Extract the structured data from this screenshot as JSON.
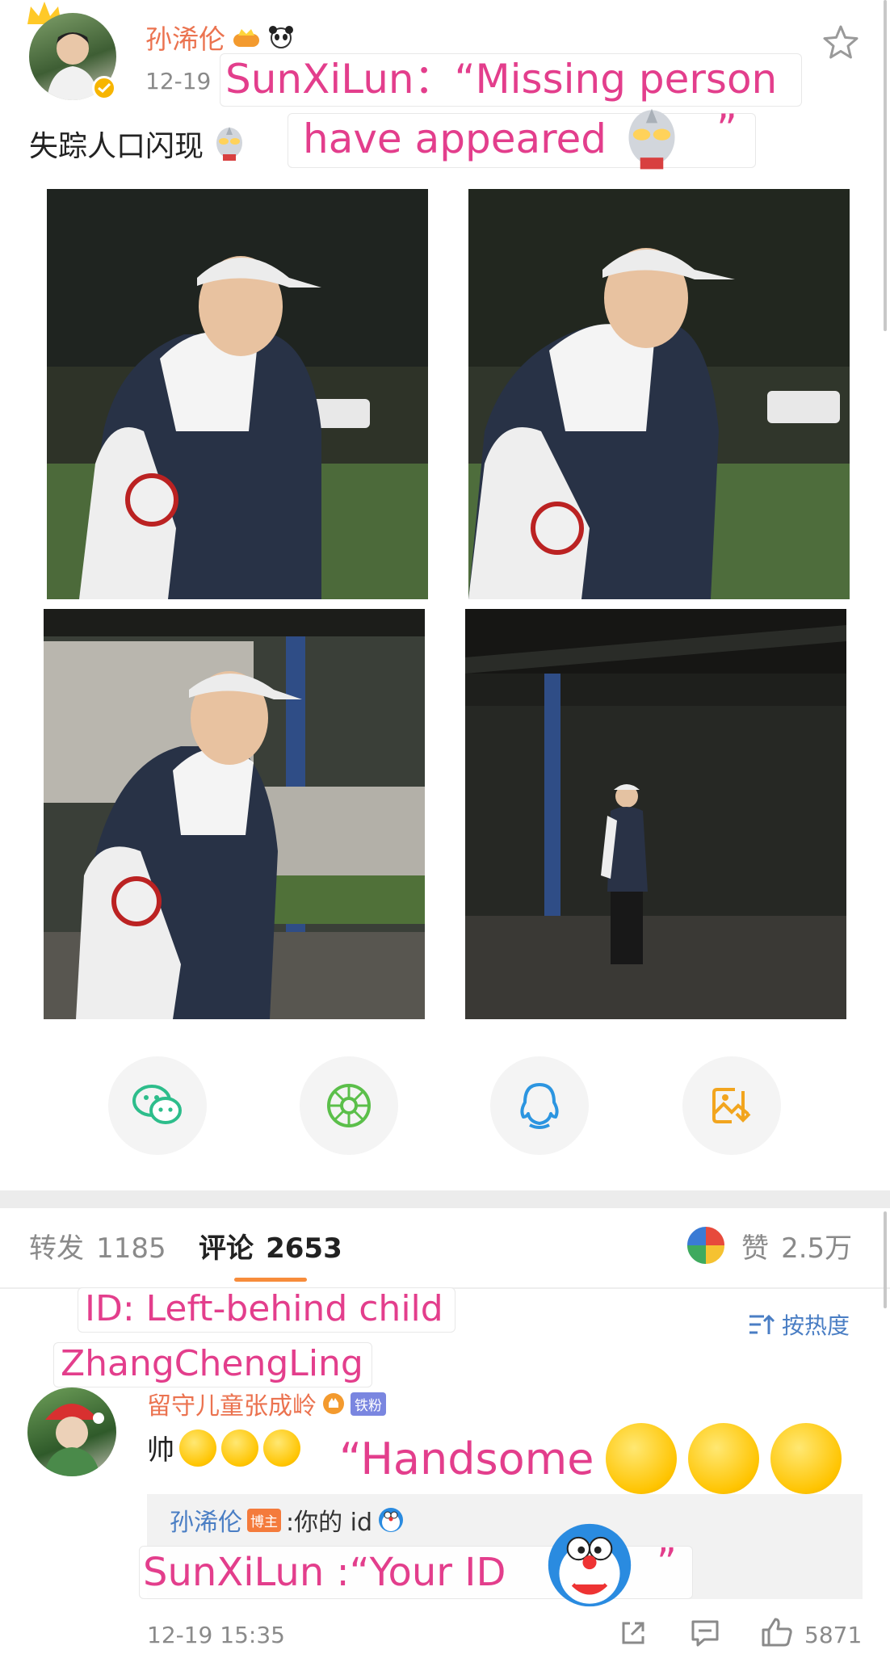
{
  "post": {
    "username": "孙浠伦",
    "date": "12-19",
    "text": "失踪人口闪现",
    "caption_line1": "SunXiLun：“Missing person",
    "caption_line2": "have appeared",
    "caption_close_quote": "”"
  },
  "share": {
    "icons": [
      "wechat-icon",
      "moments-icon",
      "qq-icon",
      "save-image-icon"
    ]
  },
  "tabs": {
    "repost_label": "转发",
    "repost_count": "1185",
    "comment_label": "评论",
    "comment_count": "2653",
    "like_label": "赞",
    "like_count": "2.5万"
  },
  "sort": {
    "label": "按热度"
  },
  "comment": {
    "id_caption_line1": "ID: Left-behind child",
    "id_caption_line2": "ZhangChengLing",
    "username": "留守儿童张成岭",
    "fan_badge": "铁粉",
    "text": "帅",
    "caption": "“Handsome",
    "reply": {
      "name": "孙浠伦",
      "host_badge": "博主",
      "text": ":你的 id",
      "caption": "SunXiLun :“Your ID",
      "caption_close_quote": "”"
    },
    "timestamp": "12-19 15:35",
    "like_count": "5871"
  },
  "colors": {
    "caption_pink": "#e33e8c",
    "username_orange": "#eb7350",
    "link_blue": "#4a7ec4",
    "tab_underline": "#f78c3b"
  }
}
